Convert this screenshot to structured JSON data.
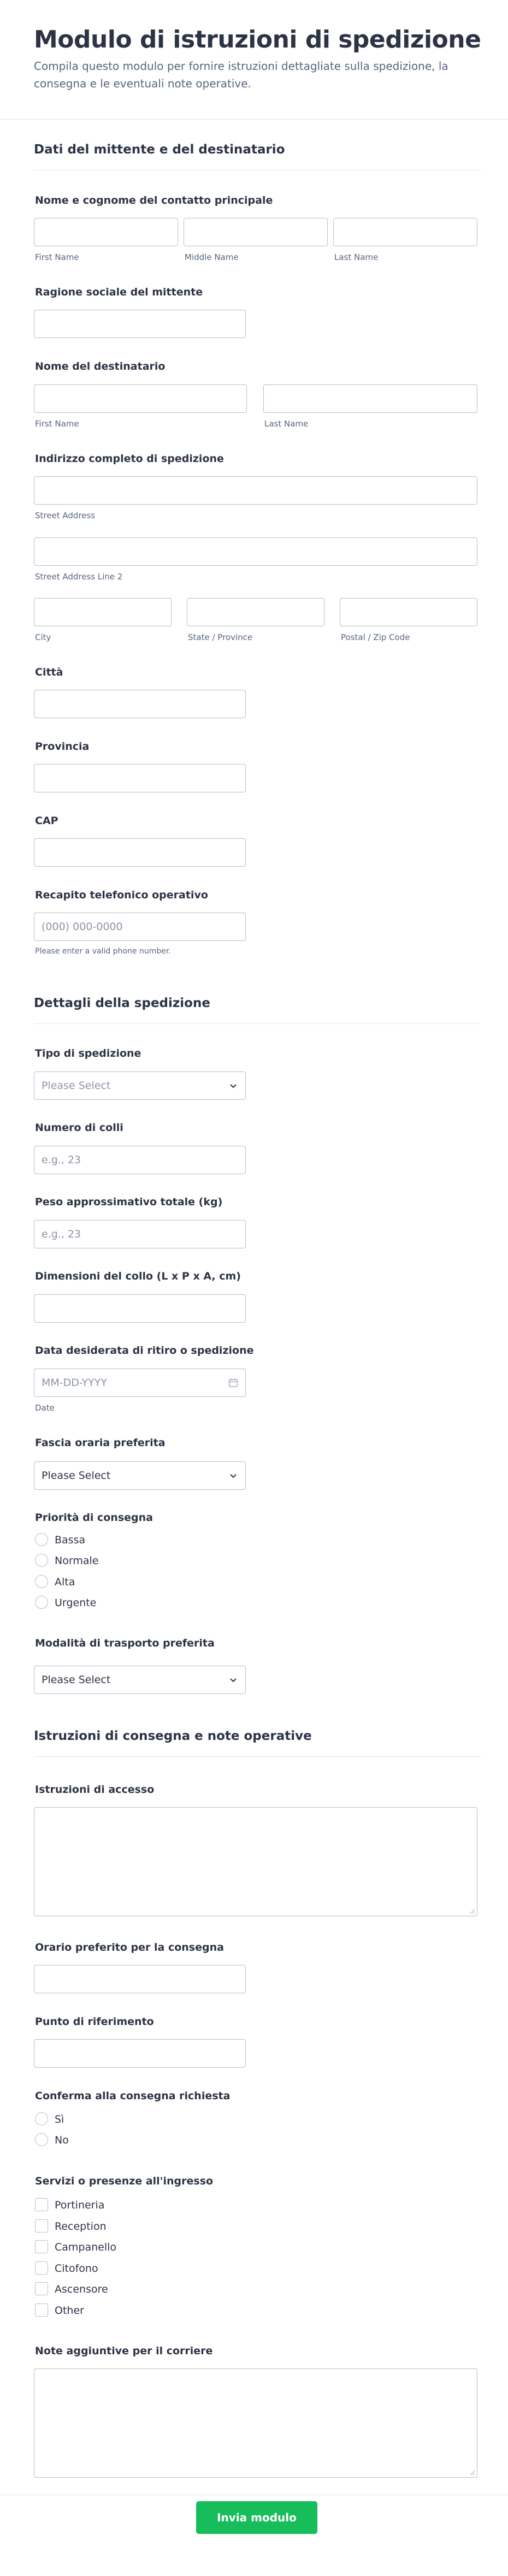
{
  "form": {
    "title": "Modulo di istruzioni di spedizione",
    "description": "Compila questo modulo per fornire istruzioni dettagliate sulla spedizione, la consegna e le eventuali note operative."
  },
  "sections": {
    "s1": "Dati del mittente e del destinatario",
    "s2": "Dettagli della spedizione",
    "s3": "Istruzioni di consegna e note operative"
  },
  "fields": {
    "contact_name": {
      "label": "Nome e cognome del contatto principale",
      "first": "First Name",
      "middle": "Middle Name",
      "last": "Last Name"
    },
    "sender_company": {
      "label": "Ragione sociale del mittente"
    },
    "recipient_name": {
      "label": "Nome del destinatario",
      "first": "First Name",
      "last": "Last Name"
    },
    "address": {
      "label": "Indirizzo completo di spedizione",
      "street": "Street Address",
      "street2": "Street Address Line 2",
      "city": "City",
      "state": "State / Province",
      "postal": "Postal / Zip Code"
    },
    "city": {
      "label": "Città"
    },
    "province": {
      "label": "Provincia"
    },
    "cap": {
      "label": "CAP"
    },
    "phone": {
      "label": "Recapito telefonico operativo",
      "placeholder": "(000) 000-0000",
      "hint": "Please enter a valid phone number."
    },
    "shipment_type": {
      "label": "Tipo di spedizione",
      "placeholder": "Please Select"
    },
    "packages": {
      "label": "Numero di colli",
      "placeholder": "e.g., 23"
    },
    "weight": {
      "label": "Peso approssimativo totale (kg)",
      "placeholder": "e.g., 23"
    },
    "dimensions": {
      "label": "Dimensioni del collo (L x P x A, cm)"
    },
    "pickup_date": {
      "label": "Data desiderata di ritiro o spedizione",
      "placeholder": "MM-DD-YYYY",
      "hint": "Date"
    },
    "time_slot": {
      "label": "Fascia oraria preferita",
      "value": "Please Select"
    },
    "priority": {
      "label": "Priorità di consegna",
      "options": [
        "Bassa",
        "Normale",
        "Alta",
        "Urgente"
      ]
    },
    "transport": {
      "label": "Modalità di trasporto preferita",
      "value": "Please Select"
    },
    "access": {
      "label": "Istruzioni di accesso"
    },
    "delivery_time": {
      "label": "Orario preferito per la consegna"
    },
    "landmark": {
      "label": "Punto di riferimento"
    },
    "confirmation": {
      "label": "Conferma alla consegna richiesta",
      "options": [
        "Sì",
        "No"
      ]
    },
    "services": {
      "label": "Servizi o presenze all'ingresso",
      "options": [
        "Portineria",
        "Reception",
        "Campanello",
        "Citofono",
        "Ascensore",
        "Other"
      ]
    },
    "notes": {
      "label": "Note aggiuntive per il corriere"
    }
  },
  "submit_label": "Invia modulo",
  "icons": {
    "select": "chevron-down-icon",
    "date": "calendar-icon",
    "resize": "resize-grip-icon"
  },
  "colors": {
    "submit": "#18bd5b",
    "text": "#2c3345",
    "border": "#b8bdc9"
  }
}
